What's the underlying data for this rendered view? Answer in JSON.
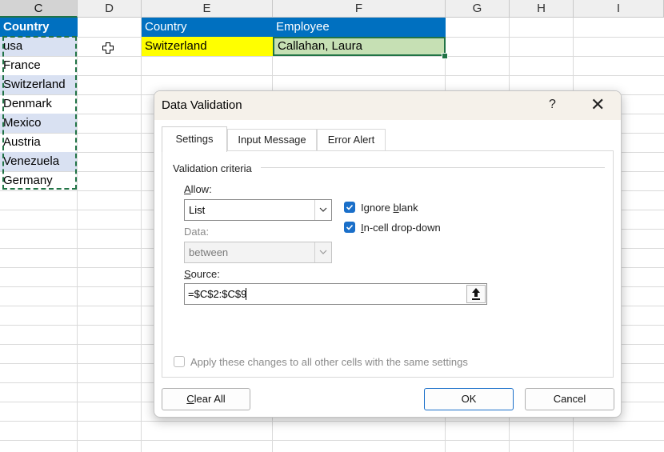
{
  "spreadsheet": {
    "columns": [
      "C",
      "D",
      "E",
      "F",
      "G",
      "H",
      "I"
    ],
    "header_row": {
      "c": "Country",
      "e": "Country",
      "f": "Employee"
    },
    "country_list": [
      "usa",
      "France",
      "Switzerland",
      "Denmark",
      "Mexico",
      "Austria",
      "Venezuela",
      "Germany"
    ],
    "selected_country": "Switzerland",
    "employee": "Callahan, Laura"
  },
  "colors": {
    "header_fill": "#0070c0",
    "list_band": "#d9e1f2",
    "yellow_fill": "#ffff00",
    "green_fill": "#c6e0b4",
    "selection_border": "#217346"
  },
  "dialog": {
    "title": "Data Validation",
    "help": "?",
    "close": "✕",
    "tabs": [
      "Settings",
      "Input Message",
      "Error Alert"
    ],
    "section": "Validation criteria",
    "allow_prefix": "",
    "allow_u": "A",
    "allow_rest": "llow:",
    "allow_value": "List",
    "data_label": "Data:",
    "data_value": "between",
    "ignore_pre": "Ignore ",
    "ignore_u": "b",
    "ignore_post": "lank",
    "ignore_checked": true,
    "dropdown_u": "I",
    "dropdown_post": "n-cell drop-down",
    "dropdown_checked": true,
    "source_u": "S",
    "source_rest": "ource:",
    "source_value": "=$C$2:$C$9",
    "apply_text": "Apply these changes to all other cells with the same settings",
    "apply_checked": false,
    "clear_u": "C",
    "clear_rest": "lear All",
    "ok": "OK",
    "cancel": "Cancel"
  }
}
